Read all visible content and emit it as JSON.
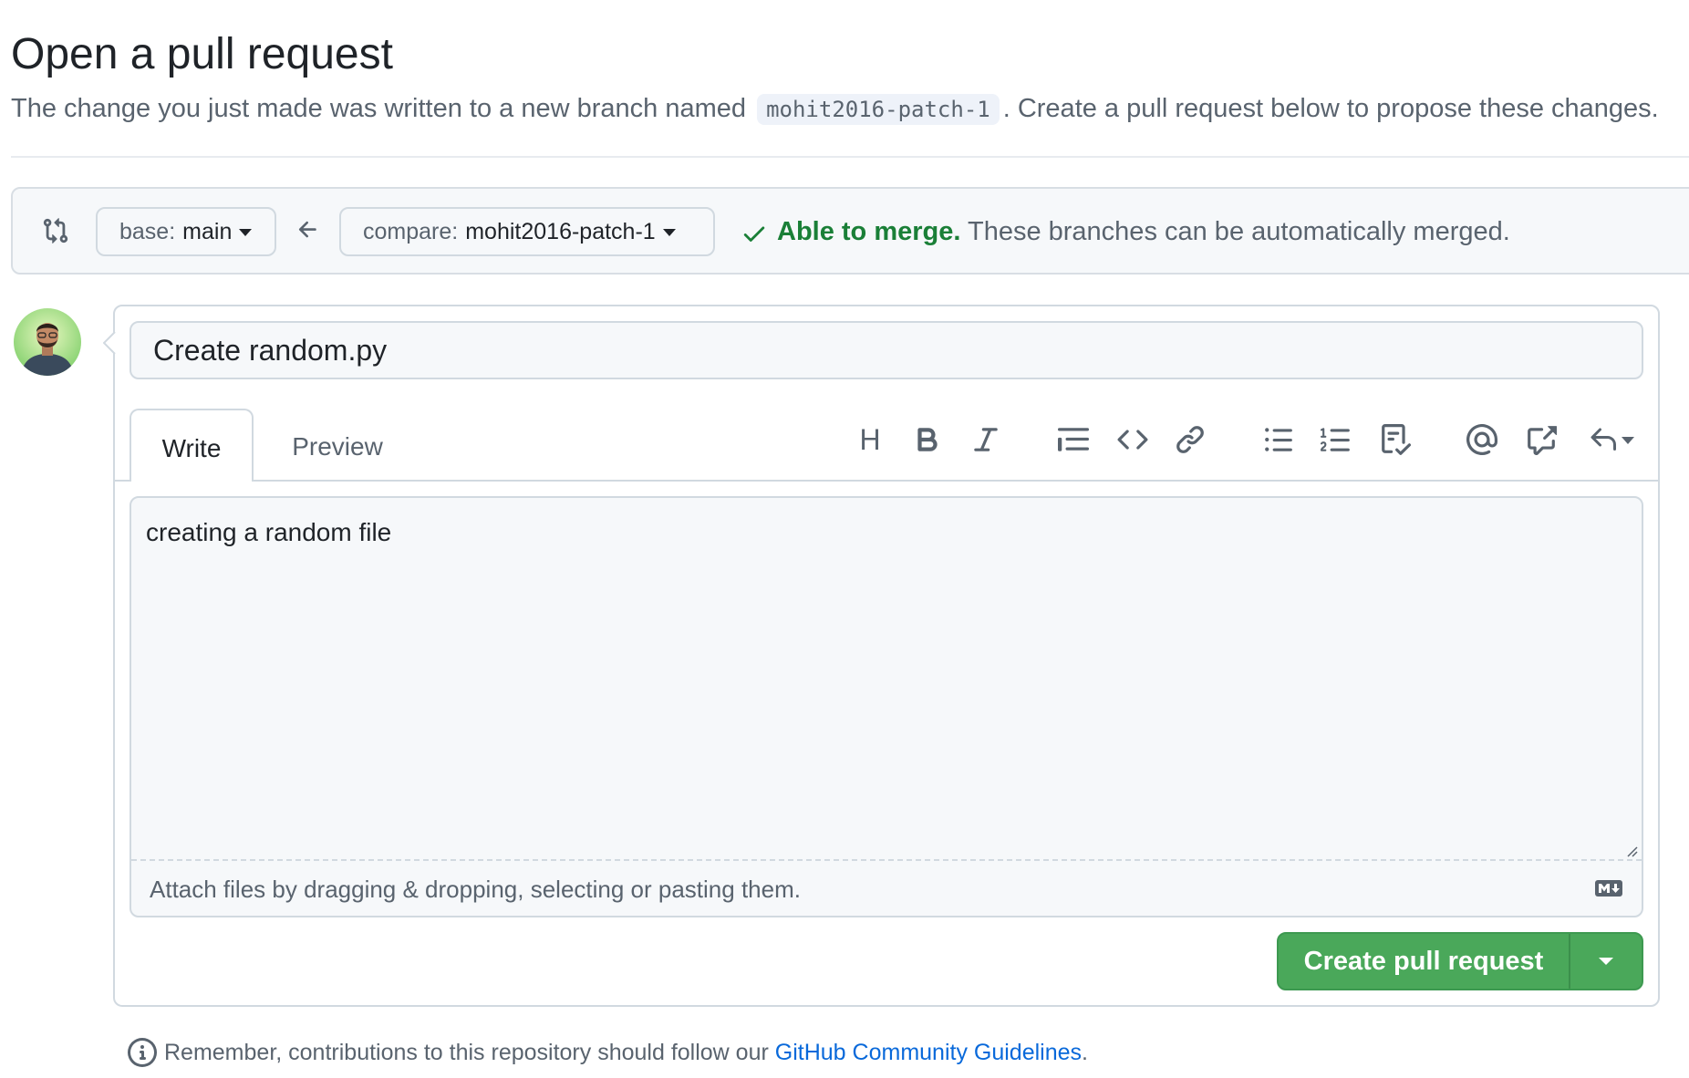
{
  "header": {
    "title": "Open a pull request",
    "subtitle_before": "The change you just made was written to a new branch named",
    "branch_name": "mohit2016-patch-1",
    "subtitle_after": ". Create a pull request below to propose these changes."
  },
  "range": {
    "base_label": "base:",
    "base_value": "main",
    "compare_label": "compare:",
    "compare_value": "mohit2016-patch-1",
    "merge_status": "Able to merge.",
    "merge_message": "These branches can be automatically merged."
  },
  "form": {
    "title_value": "Create random.py",
    "tabs": [
      {
        "label": "Write"
      },
      {
        "label": "Preview"
      }
    ],
    "heading_tool": "H",
    "body_value": "creating a random file",
    "attach_hint": "Attach files by dragging & dropping, selecting or pasting them.",
    "submit_label": "Create pull request"
  },
  "footer": {
    "note_before": "Remember, contributions to this repository should follow our",
    "link_text": "GitHub Community Guidelines",
    "note_after": "."
  },
  "colors": {
    "accent_green": "#4aa85a",
    "merge_green": "#1a7f37",
    "link_blue": "#0969da"
  }
}
